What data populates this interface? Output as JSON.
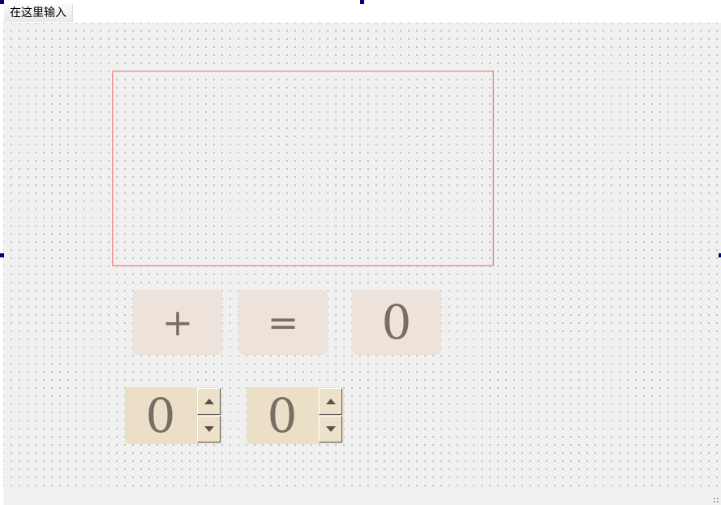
{
  "menubar": {
    "items": [
      {
        "label": "在这里输入"
      }
    ]
  },
  "form": {
    "operator_button": {
      "label": "+"
    },
    "equals_button": {
      "label": "="
    },
    "result_display": {
      "value": "0"
    },
    "operand_a": {
      "value": "0"
    },
    "operand_b": {
      "value": "0"
    }
  },
  "icons": {
    "spin_up": "triangle-up-icon",
    "spin_down": "triangle-down-icon",
    "resize_grip": "resize-grip-icon"
  },
  "colors": {
    "canvas_bg": "#f0f0f0",
    "button_bg": "#ede3da",
    "spinbox_bg": "#ebdfc8",
    "text_color": "#7a6e63",
    "display_border": "#f08a8a",
    "selection_handle": "#000080"
  }
}
